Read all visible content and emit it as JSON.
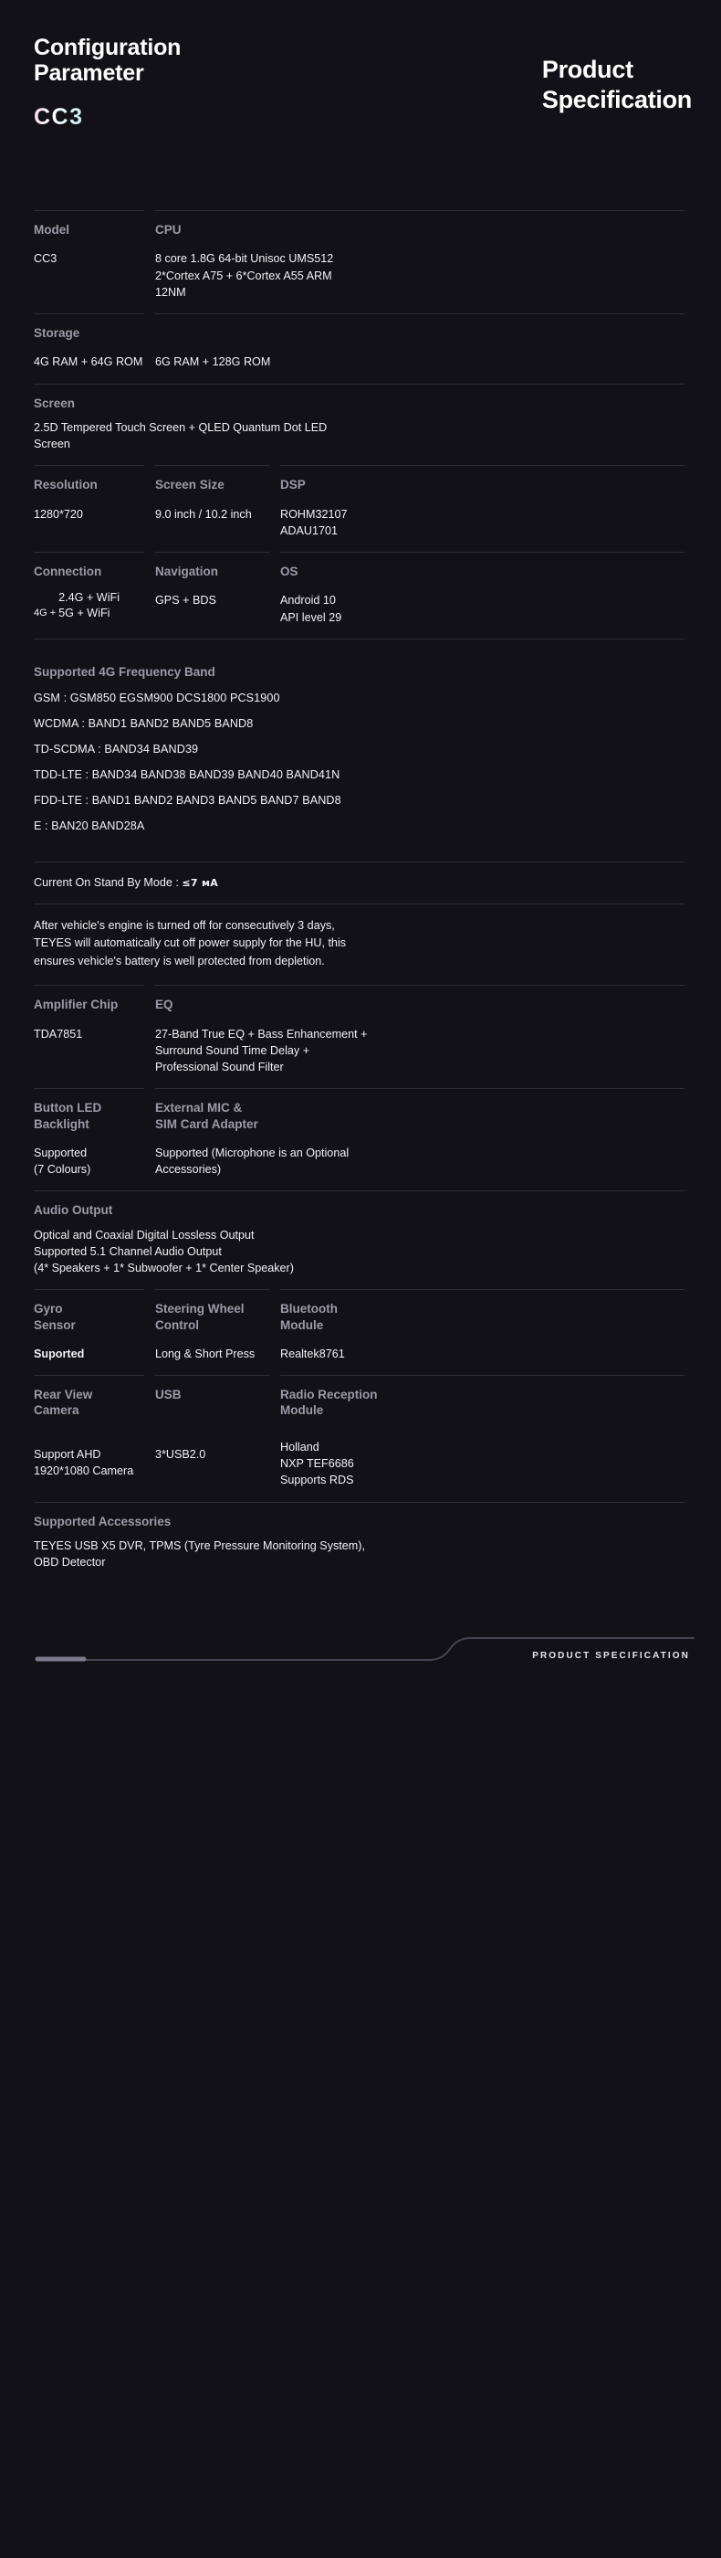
{
  "header": {
    "title": "Configuration\nParameter",
    "logo": "CC3",
    "subtitle": "Product\nSpecification"
  },
  "specs": {
    "model_label": "Model",
    "model_value": "CC3",
    "cpu_label": "CPU",
    "cpu_value": "8 core 1.8G 64-bit Unisoc UMS512\n2*Cortex A75 + 6*Cortex A55 ARM\n12NM",
    "storage_label": "Storage",
    "storage_value_1": "4G RAM + 64G ROM",
    "storage_value_2": "6G RAM + 128G ROM",
    "screen_label": "Screen",
    "screen_value": "2.5D Tempered Touch Screen + QLED Quantum Dot LED\nScreen",
    "resolution_label": "Resolution",
    "resolution_value": "1280*720",
    "screen_size_label": "Screen Size",
    "screen_size_value": "9.0 inch / 10.2 inch",
    "dsp_label": "DSP",
    "dsp_value": "ROHM32107\nADAU1701",
    "connection_label": "Connection",
    "connection_prefix": "4G +",
    "connection_stack": "2.4G + WiFi\n5G + WiFi",
    "navigation_label": "Navigation",
    "navigation_value": "GPS + BDS",
    "os_label": "OS",
    "os_value": "Android 10\nAPI level 29",
    "band_heading": "Supported 4G Frequency Band",
    "bands": [
      "GSM :  GSM850  EGSM900  DCS1800  PCS1900",
      "WCDMA :  BAND1  BAND2  BAND5  BAND8",
      "TD-SCDMA :  BAND34  BAND39",
      "TDD-LTE :  BAND34  BAND38  BAND39  BAND40  BAND41N",
      "FDD-LTE :  BAND1  BAND2  BAND3  BAND5  BAND7  BAND8",
      "E :  BAN20  BAND28A"
    ],
    "standby_label": "Current On Stand By Mode :",
    "standby_value": "≤7 мA",
    "note": "After vehicle's engine is turned off for consecutively 3 days,\nTEYES will automatically cut off power supply for the HU, this\nensures vehicle's battery is well protected from depletion.",
    "amplifier_label": "Amplifier Chip",
    "amplifier_value": "TDA7851",
    "eq_label": "EQ",
    "eq_value": "27-Band True EQ + Bass Enhancement +\nSurround Sound Time Delay +\nProfessional Sound Filter",
    "button_led_label": "Button LED\nBacklight",
    "button_led_value": "Supported\n(7 Colours)",
    "mic_sim_label": "External MIC &\nSIM Card Adapter",
    "mic_sim_value": "Supported (Microphone is an Optional\nAccessories)",
    "audio_output_label": "Audio Output",
    "audio_output_value": "Optical and Coaxial Digital Lossless Output\nSupported 5.1 Channel Audio Output\n(4* Speakers + 1* Subwoofer + 1* Center Speaker)",
    "gyro_label": "Gyro\nSensor",
    "gyro_value": "Suported",
    "swc_label": "Steering Wheel\nControl",
    "swc_value": "Long & Short Press",
    "bluetooth_label": "Bluetooth\nModule",
    "bluetooth_value": "Realtek8761",
    "rear_camera_label": "Rear View\nCamera",
    "rear_camera_value": "Support AHD\n1920*1080 Camera",
    "usb_label": "USB",
    "usb_value": "3*USB2.0",
    "radio_label": "Radio Reception\nModule",
    "radio_value": "Holland\nNXP TEF6686\nSupports RDS",
    "accessories_label": "Supported Accessories",
    "accessories_value": "TEYES USB X5 DVR, TPMS (Tyre Pressure Monitoring System),\nOBD Detector"
  },
  "footer": {
    "label": "PRODUCT SPECIFICATION"
  },
  "colors": {
    "background": "#121117",
    "label": "#9b9aa8",
    "value": "#f2f1f5",
    "divider": "#2e2d36",
    "footer_line": "#45434f",
    "footer_accent": "#6f6d7c"
  }
}
